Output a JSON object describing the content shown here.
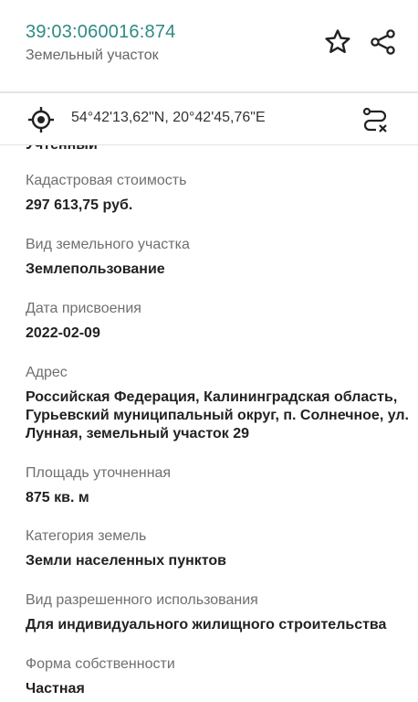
{
  "header": {
    "cadastral_number": "39:03:060016:874",
    "object_type": "Земельный участок"
  },
  "icons": {
    "star": "star-icon",
    "share": "share-icon",
    "target": "crosshair-icon",
    "route": "route-icon"
  },
  "coords": {
    "text": "54°42'13,62\"N, 20°42'45,76\"E"
  },
  "partial_value": "Учтенный",
  "fields": [
    {
      "label": "Кадастровая стоимость",
      "value": "297 613,75 руб."
    },
    {
      "label": "Вид земельного участка",
      "value": "Землепользование"
    },
    {
      "label": "Дата присвоения",
      "value": "2022-02-09"
    },
    {
      "label": "Адрес",
      "value": "Российская Федерация, Калининградская область, Гурьевский муниципальный округ, п. Солнечное, ул. Лунная, земельный участок 29"
    },
    {
      "label": "Площадь уточненная",
      "value": "875 кв. м"
    },
    {
      "label": "Категория земель",
      "value": "Земли населенных пунктов"
    },
    {
      "label": "Вид разрешенного использования",
      "value": "Для индивидуального жилищного строительства"
    },
    {
      "label": "Форма собственности",
      "value": "Частная"
    }
  ],
  "colors": {
    "accent": "#2f8a83",
    "label": "#6f6f6f",
    "value": "#222222"
  }
}
